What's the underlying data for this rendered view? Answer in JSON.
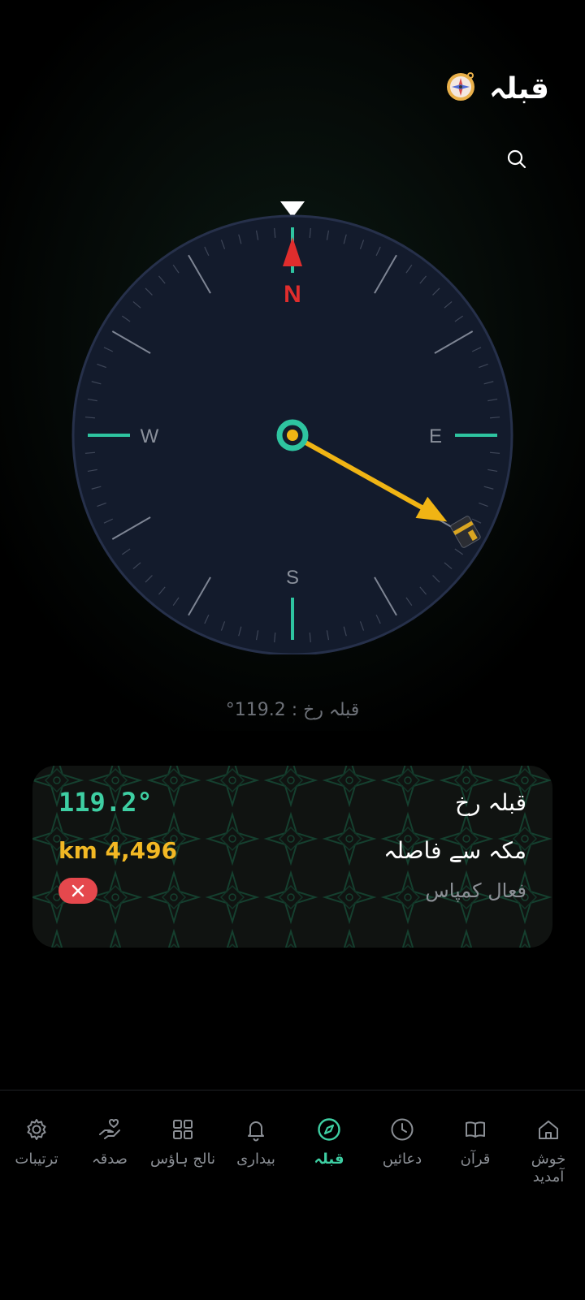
{
  "header": {
    "title": "قبلہ",
    "icon": "compass-emoji-icon"
  },
  "compass": {
    "heading_deg": 0,
    "qibla_deg": 119.2,
    "labels": {
      "north": "N",
      "east": "E",
      "south": "S",
      "west": "W"
    },
    "colors": {
      "dial": "#131b2c",
      "accent": "#2ec4a0",
      "north": "#e02d2d",
      "arrow": "#f0b414"
    }
  },
  "bearing_text": "قبلہ رخ : 119.2°",
  "info_card": {
    "qibla_label": "قبلہ رخ",
    "qibla_value": "119.2°",
    "distance_label": "مکہ سے فاصلہ",
    "distance_value": "km 4,496",
    "compass_label": "فعال کمپاس",
    "compass_status": "inactive"
  },
  "nav": {
    "items": [
      {
        "label": "ترتیبات",
        "icon": "gear-icon"
      },
      {
        "label": "صدقہ",
        "icon": "hand-heart-icon"
      },
      {
        "label": "نالج ہاؤس",
        "icon": "grid-icon"
      },
      {
        "label": "بیداری",
        "icon": "bell-icon"
      },
      {
        "label": "قبلہ",
        "icon": "compass-icon",
        "active": true
      },
      {
        "label": "دعائیں",
        "icon": "clock-icon"
      },
      {
        "label": "قرآن",
        "icon": "book-icon"
      },
      {
        "label": "خوش آمدید",
        "icon": "home-icon"
      }
    ]
  }
}
